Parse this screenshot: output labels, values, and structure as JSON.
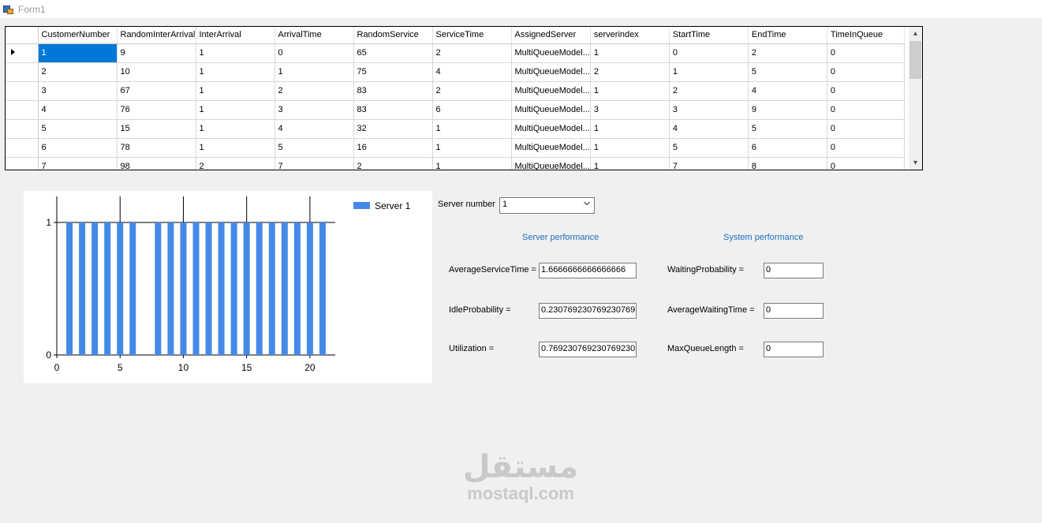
{
  "window": {
    "title": "Form1"
  },
  "grid": {
    "columns": [
      "CustomerNumber",
      "RandomInterArrival",
      "InterArrival",
      "ArrivalTime",
      "RandomService",
      "ServiceTime",
      "AssignedServer",
      "serverindex",
      "StartTime",
      "EndTime",
      "TimeInQueue"
    ],
    "rows": [
      [
        "1",
        "9",
        "1",
        "0",
        "65",
        "2",
        "MultiQueueModel...",
        "1",
        "0",
        "2",
        "0"
      ],
      [
        "2",
        "10",
        "1",
        "1",
        "75",
        "4",
        "MultiQueueModel...",
        "2",
        "1",
        "5",
        "0"
      ],
      [
        "3",
        "67",
        "1",
        "2",
        "83",
        "2",
        "MultiQueueModel...",
        "1",
        "2",
        "4",
        "0"
      ],
      [
        "4",
        "76",
        "1",
        "3",
        "83",
        "6",
        "MultiQueueModel...",
        "3",
        "3",
        "9",
        "0"
      ],
      [
        "5",
        "15",
        "1",
        "4",
        "32",
        "1",
        "MultiQueueModel...",
        "1",
        "4",
        "5",
        "0"
      ],
      [
        "6",
        "78",
        "1",
        "5",
        "16",
        "1",
        "MultiQueueModel...",
        "1",
        "5",
        "6",
        "0"
      ],
      [
        "7",
        "98",
        "2",
        "7",
        "2",
        "1",
        "MultiQueueModel...",
        "1",
        "7",
        "8",
        "0"
      ]
    ],
    "selected_row": 0
  },
  "chart_data": {
    "type": "bar",
    "series": [
      {
        "name": "Server 1",
        "color": "#4589e8",
        "x": [
          1,
          2,
          3,
          4,
          5,
          6,
          8,
          9,
          10,
          11,
          12,
          13,
          14,
          15,
          16,
          17,
          18,
          19,
          20,
          21
        ],
        "values": [
          1,
          1,
          1,
          1,
          1,
          1,
          1,
          1,
          1,
          1,
          1,
          1,
          1,
          1,
          1,
          1,
          1,
          1,
          1,
          1
        ]
      }
    ],
    "xlim": [
      0,
      22
    ],
    "ylim": [
      0,
      1
    ],
    "xticks": [
      "0",
      "5",
      "10",
      "15",
      "20"
    ],
    "xtick_values": [
      0,
      5,
      10,
      15,
      20
    ],
    "yticks": [
      "0",
      "1"
    ],
    "ytick_values": [
      0,
      1
    ],
    "grid": "vertical at 5,10,15,20",
    "legend_position": "top-right"
  },
  "controls": {
    "server_number_label": "Server number",
    "server_number_value": "1",
    "server_performance_label": "Server performance",
    "system_performance_label": "System performance",
    "avg_service_time_label": "AverageServiceTime =",
    "avg_service_time_value": "1.6666666666666666",
    "idle_probability_label": "IdleProbability =",
    "idle_probability_value": "0.230769230769230769",
    "utilization_label": "Utilization =",
    "utilization_value": "0.769230769230769230",
    "waiting_probability_label": "WaitingProbability =",
    "waiting_probability_value": "0",
    "avg_waiting_time_label": "AverageWaitingTime =",
    "avg_waiting_time_value": "0",
    "max_queue_length_label": "MaxQueueLength =",
    "max_queue_length_value": "0"
  },
  "watermark": {
    "arabic": "مستقل",
    "latin": "mostaql.com"
  }
}
